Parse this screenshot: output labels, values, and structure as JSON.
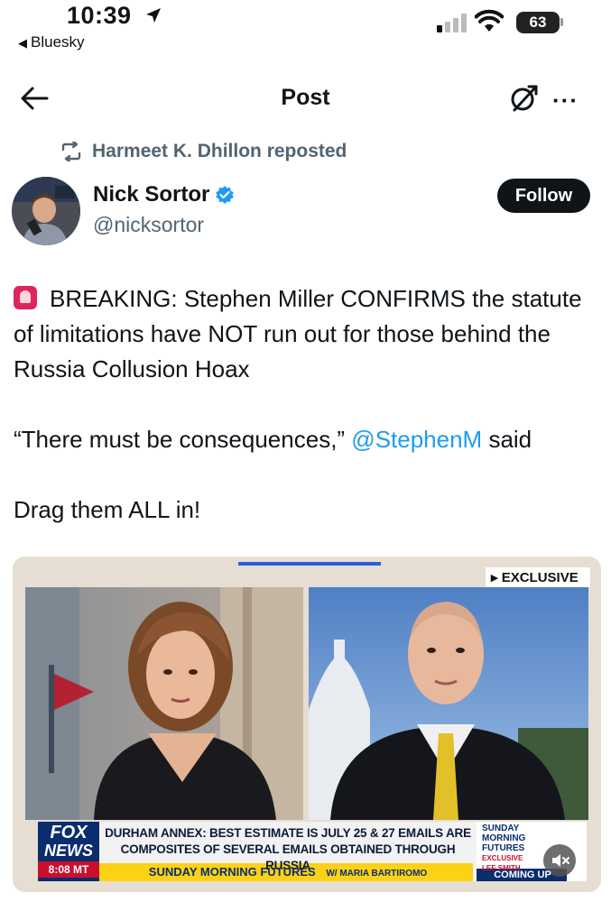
{
  "status_bar": {
    "time": "10:39",
    "back_app": "Bluesky",
    "battery": "63"
  },
  "header": {
    "title": "Post"
  },
  "repost": {
    "text": "Harmeet K. Dhillon reposted"
  },
  "author": {
    "name": "Nick Sortor",
    "handle": "@nicksortor",
    "follow_label": "Follow"
  },
  "post": {
    "line1": "BREAKING: Stephen Miller CONFIRMS the statute of limitations have NOT run out for those behind the Russia Collusion Hoax",
    "quote_before": "“There must be consequences,” ",
    "mention": "@StephenM",
    "quote_after": " said",
    "line3": "Drag them ALL in!"
  },
  "media": {
    "exclusive_label": "▸ EXCLUSIVE",
    "headline_line1": "DURHAM ANNEX: BEST ESTIMATE IS JULY 25 & 27 EMAILS ARE",
    "headline_line2": "COMPOSITES OF SEVERAL EMAILS OBTAINED THROUGH RUSSIA",
    "show_name": "SUNDAY MORNING FUTURES",
    "host": "W/ MARIA BARTIROMO",
    "network_top": "FOX",
    "network_bottom": "NEWS",
    "clock": "8:08 MT",
    "side_logo_1": "SUNDAY",
    "side_logo_2": "MORNING",
    "side_logo_3": "FUTURES",
    "side_exclusive": "EXCLUSIVE",
    "side_name": "LEE SMITH",
    "coming_up": "COMING UP"
  },
  "colors": {
    "accent": "#1d9bf0",
    "text": "#0f1419",
    "muted": "#536471",
    "fox_blue": "#0a2d6e",
    "fox_red": "#c8102e"
  }
}
